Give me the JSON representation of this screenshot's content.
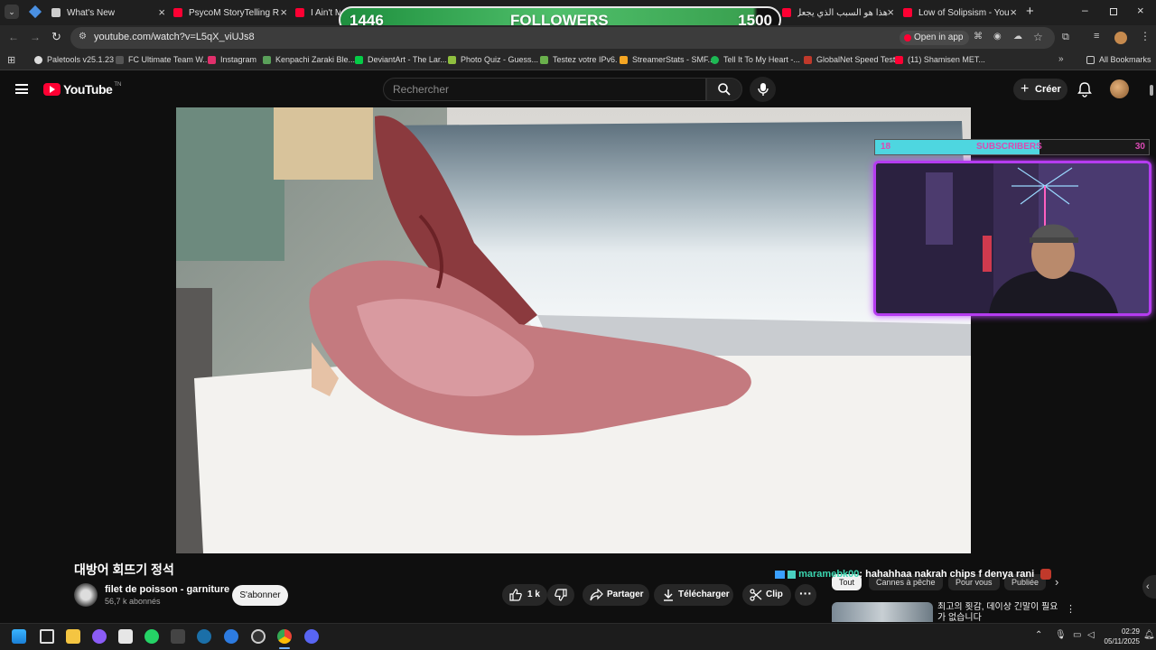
{
  "overlays": {
    "followers": {
      "current": "1446",
      "label": "FOLLOWERS",
      "goal": "1500",
      "progress": 0.964
    },
    "subscribers": {
      "current": "18",
      "label": "SUBSCRIBERS",
      "goal": "30",
      "progress": 0.6
    }
  },
  "tabs": [
    {
      "title": "What's New",
      "icon": "github-icon"
    },
    {
      "title": "PsycoM StoryTelling Rea",
      "icon": "youtube-icon"
    },
    {
      "title": "I Ain't M",
      "icon": "youtube-icon"
    },
    {
      "title": "هذا هو السبب الذي يجعل",
      "icon": "youtube-icon"
    },
    {
      "title": "Low of Solipsism - YouT",
      "icon": "youtube-icon"
    }
  ],
  "browser": {
    "url": "youtube.com/watch?v=L5qX_viUJs8",
    "open_in_app": "Open in app"
  },
  "bookmarks": [
    {
      "label": "Paletools v25.1.23",
      "color": "#ddd"
    },
    {
      "label": "FC Ultimate Team W...",
      "color": "#555"
    },
    {
      "label": "Instagram",
      "color": "#e1306c"
    },
    {
      "label": "Kenpachi Zaraki Ble...",
      "color": "#5aa05a"
    },
    {
      "label": "DeviantArt - The Lar...",
      "color": "#05cc47"
    },
    {
      "label": "Photo Quiz - Guess...",
      "color": "#8fbf3f"
    },
    {
      "label": "Testez votre IPv6.",
      "color": "#6ab04c"
    },
    {
      "label": "StreamerStats - SMF...",
      "color": "#f5a623"
    },
    {
      "label": "Tell It To My Heart -...",
      "color": "#1db954"
    },
    {
      "label": "GlobalNet Speed Test",
      "color": "#c0392b"
    },
    {
      "label": "(11) Shamisen MET...",
      "color": "#ff0033"
    }
  ],
  "all_bookmarks": "All Bookmarks",
  "youtube": {
    "logo": "YouTube",
    "logo_region": "TN",
    "search_placeholder": "Rechercher",
    "create_label": "Créer"
  },
  "video": {
    "title": "대방어 회뜨기 정석",
    "channel_name": "filet de poisson - garniture",
    "channel_subs": "56,7 k abonnés",
    "subscribe_label": "S'abonner",
    "likes": "1 k",
    "share_label": "Partager",
    "download_label": "Télécharger",
    "clip_label": "Clip"
  },
  "chips": [
    "Tout",
    "Cannes à pêche",
    "Pour vous",
    "Publiée"
  ],
  "recommended": {
    "title": "최고의 횟감, 데이상 긴말이 필요 가 없습니다"
  },
  "chat": {
    "user": "maramebk00",
    "message": ": hahahhaa nakrah chips f denya rani"
  },
  "taskbar": {
    "time": "02:29",
    "date": "05/11/2025"
  }
}
